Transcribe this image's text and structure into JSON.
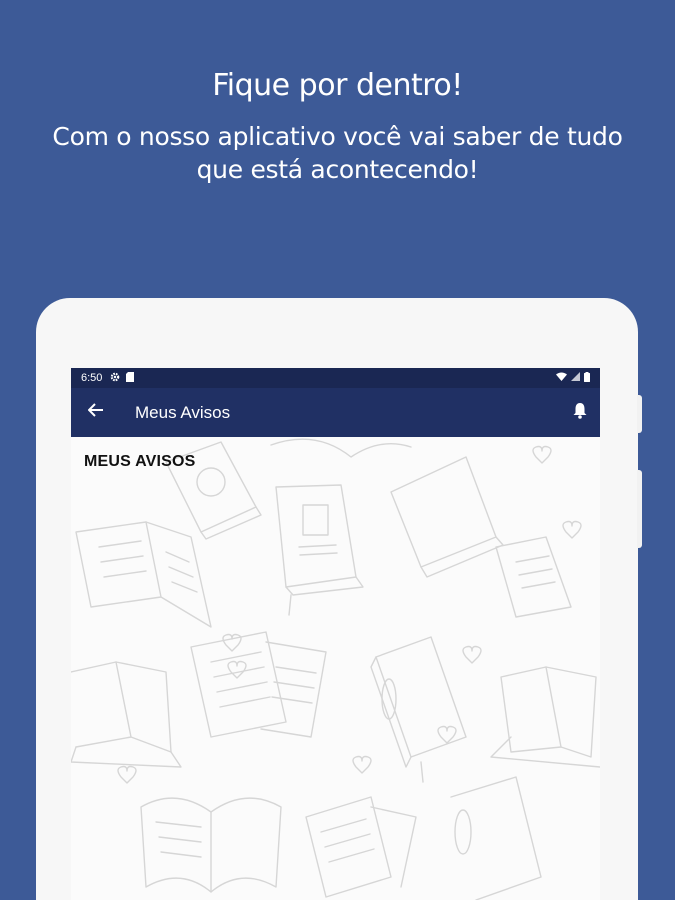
{
  "promo": {
    "title": "Fique por dentro!",
    "subtitle": "Com o nosso aplicativo você vai saber de tudo que está acontecendo!"
  },
  "status_bar": {
    "time": "6:50",
    "icons": [
      "settings-icon",
      "sd-card-icon",
      "wifi-icon",
      "signal-icon",
      "battery-icon"
    ]
  },
  "app_bar": {
    "title": "Meus Avisos",
    "back_icon": "arrow-back-icon",
    "action_icon": "bell-icon"
  },
  "content": {
    "heading": "MEUS AVISOS"
  },
  "colors": {
    "background": "#3d5a97",
    "status_bar": "#1a2753",
    "app_bar": "#203064",
    "screen": "#fbfbfb"
  }
}
